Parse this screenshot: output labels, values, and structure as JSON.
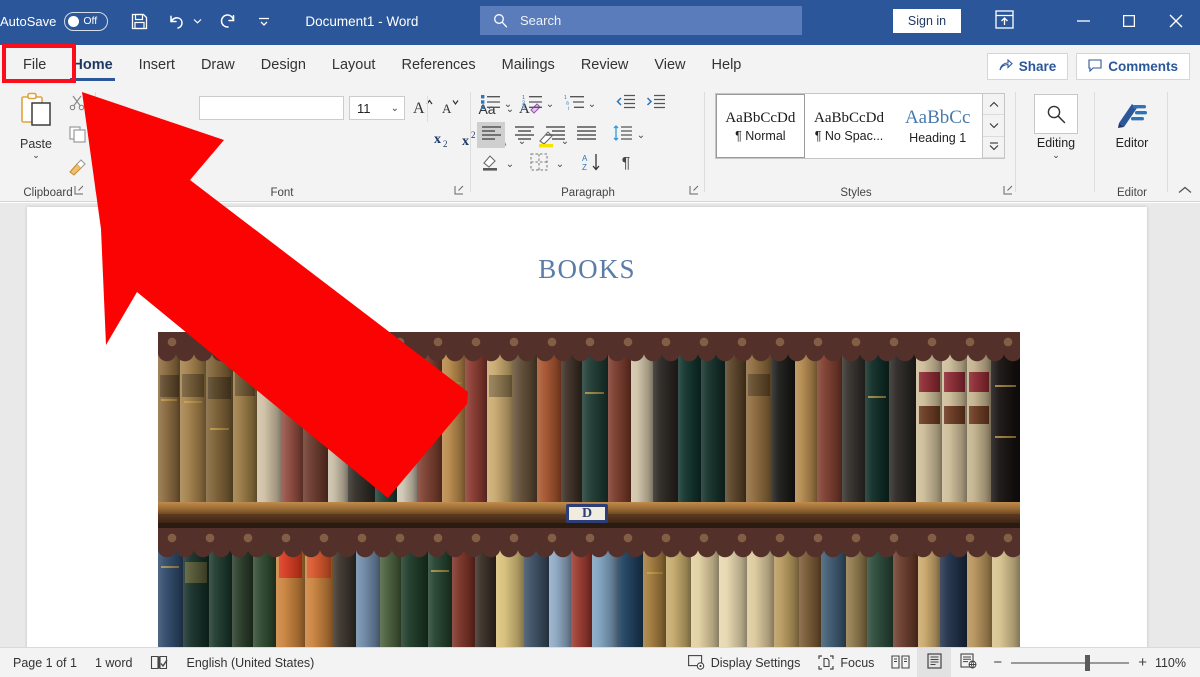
{
  "titlebar": {
    "autosave_label": "AutoSave",
    "autosave_state": "Off",
    "save_icon": "save-icon",
    "undo_icon": "undo-icon",
    "redo_icon": "redo-icon",
    "customize_qat_icon": "customize-quick-access-toolbar-icon",
    "document_title": "Document1  -  Word",
    "search_icon": "search-icon",
    "search_placeholder": "Search",
    "signin_label": "Sign in",
    "ribbon_display_icon": "ribbon-display-options-icon",
    "minimize_icon": "minimize-icon",
    "maximize_icon": "maximize-icon",
    "close_icon": "close-icon"
  },
  "tabs": [
    {
      "label": "File",
      "active": false
    },
    {
      "label": "Home",
      "active": true
    },
    {
      "label": "Insert",
      "active": false
    },
    {
      "label": "Draw",
      "active": false
    },
    {
      "label": "Design",
      "active": false
    },
    {
      "label": "Layout",
      "active": false
    },
    {
      "label": "References",
      "active": false
    },
    {
      "label": "Mailings",
      "active": false
    },
    {
      "label": "Review",
      "active": false
    },
    {
      "label": "View",
      "active": false
    },
    {
      "label": "Help",
      "active": false
    }
  ],
  "tabstrip_right": {
    "share_label": "Share",
    "share_icon": "share-icon",
    "comments_label": "Comments",
    "comments_icon": "comment-icon"
  },
  "highlight": {
    "target": "File",
    "box_color": "#fc0d1b",
    "arrow_color": "#fc0303",
    "arrow_points_to": "File"
  },
  "ribbon": {
    "groups": [
      {
        "name": "Clipboard",
        "label": "Clipboard"
      },
      {
        "name": "Font",
        "label": "Font"
      },
      {
        "name": "Paragraph",
        "label": "Paragraph"
      },
      {
        "name": "Styles",
        "label": "Styles"
      },
      {
        "name": "Editing",
        "label": ""
      },
      {
        "name": "Editor",
        "label": "Editor"
      }
    ],
    "clipboard": {
      "paste_label": "Paste",
      "paste_icon": "paste-icon",
      "paste_caret": "⌄",
      "cut_icon": "scissors-icon",
      "copy_icon": "copy-icon",
      "format_painter_icon": "format-painter-icon"
    },
    "font": {
      "font_name_value": "",
      "font_size_value": "11",
      "caret": "⌄",
      "grow_font_icon": "grow-font-icon",
      "shrink_font_icon": "shrink-font-icon",
      "change_case_icon": "change-case-icon",
      "change_case_label": "Aa",
      "clear_formatting_icon": "clear-formatting-icon",
      "subscript_icon": "subscript-icon",
      "superscript_icon": "superscript-icon",
      "text_effects_icon": "text-effects-icon",
      "highlight_icon": "text-highlight-color-icon",
      "font_color_icon": "font-color-icon"
    },
    "paragraph": {
      "bullets_icon": "bullets-icon",
      "numbering_icon": "numbering-icon",
      "multilevel_icon": "multilevel-list-icon",
      "decrease_indent_icon": "decrease-indent-icon",
      "increase_indent_icon": "increase-indent-icon",
      "align_left_icon": "align-left-icon",
      "align_center_icon": "align-center-icon",
      "align_right_icon": "align-right-icon",
      "justify_icon": "justify-icon",
      "line_spacing_icon": "line-spacing-icon",
      "shading_icon": "shading-icon",
      "borders_icon": "borders-icon",
      "sort_icon": "sort-icon",
      "show_marks_icon": "show-formatting-marks-icon"
    },
    "styles": {
      "items": [
        {
          "sample": "AaBbCcDd",
          "name": "¶ Normal",
          "selected": true
        },
        {
          "sample": "AaBbCcDd",
          "name": "¶ No Spac...",
          "selected": false
        },
        {
          "sample": "AaBbCc",
          "name": "Heading 1",
          "selected": false
        }
      ],
      "scroll_up_icon": "scroll-up-icon",
      "scroll_down_icon": "scroll-down-icon",
      "more_styles_icon": "more-styles-icon"
    },
    "editing": {
      "label": "Editing",
      "icon": "find-search-icon",
      "caret": "⌄"
    },
    "editor": {
      "label": "Editor",
      "icon": "editor-pen-icon"
    },
    "collapse_icon": "collapse-ribbon-icon"
  },
  "document": {
    "title_text": "BOOKS",
    "image": {
      "name": "bookshelf-photo",
      "shelf_plate_letter": "D"
    }
  },
  "statusbar": {
    "page_label": "Page 1 of 1",
    "word_count": "1 word",
    "proofing_icon": "proofing-errors-icon",
    "language": "English (United States)",
    "display_settings_label": "Display Settings",
    "display_settings_icon": "display-settings-icon",
    "focus_label": "Focus",
    "focus_icon": "focus-icon",
    "read_mode_icon": "read-mode-icon",
    "print_layout_icon": "print-layout-icon",
    "web_layout_icon": "web-layout-icon",
    "zoom_out_label": "−",
    "zoom_in_label": "+",
    "zoom_level": "110%"
  }
}
